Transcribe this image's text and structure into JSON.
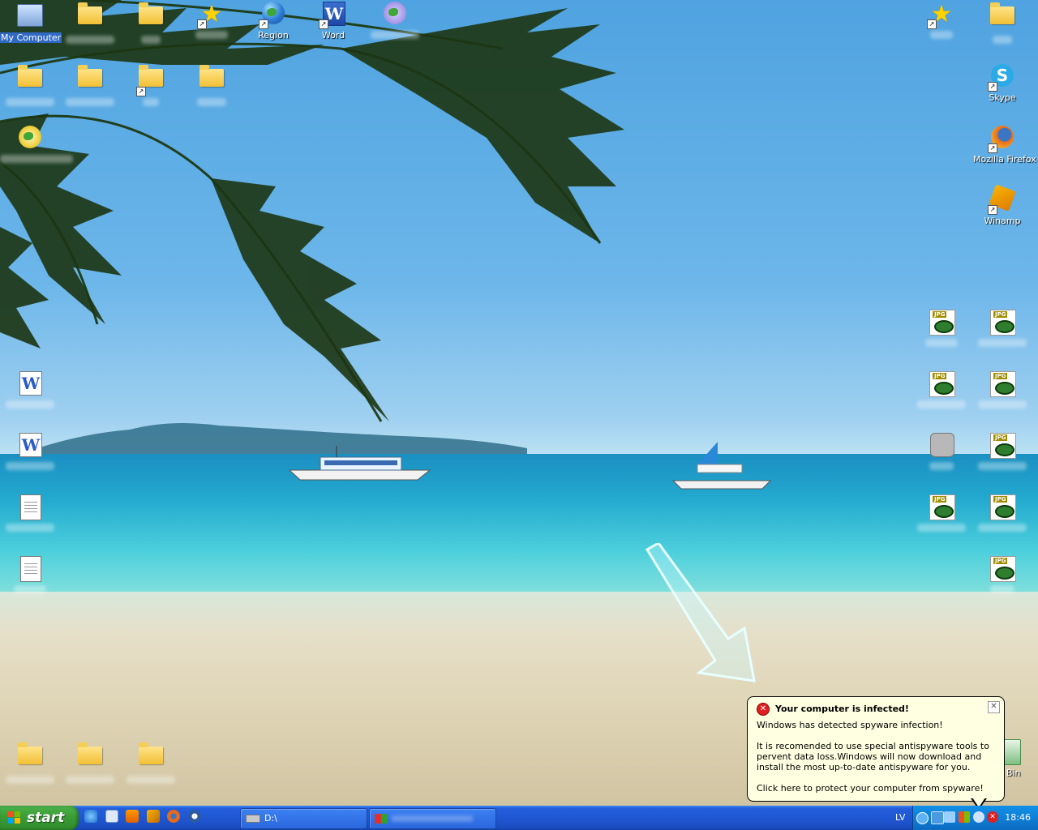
{
  "desktop": {
    "icons_left_top": [
      {
        "label": "My Computer",
        "type": "computer",
        "selected": true
      },
      {
        "label": "",
        "type": "folder"
      },
      {
        "label": "",
        "type": "folder"
      },
      {
        "label": "",
        "type": "star"
      },
      {
        "label": "Region",
        "type": "globe",
        "shortcut": true
      },
      {
        "label": "Word",
        "type": "word",
        "shortcut": true
      },
      {
        "label": "",
        "type": "blurred"
      }
    ],
    "icons_right": [
      {
        "label": "Skype",
        "type": "skype",
        "shortcut": true
      },
      {
        "label": "Mozilla Firefox",
        "type": "firefox",
        "shortcut": true
      },
      {
        "label": "Winamp",
        "type": "winamp",
        "shortcut": true
      },
      {
        "label": "le Bin",
        "type": "recycle"
      }
    ]
  },
  "balloon": {
    "title": "Your computer is infected!",
    "line1": "Windows has detected spyware infection!",
    "line2": "It is recomended to use special antispyware tools to pervent data loss.Windows will now download and install the most up-to-date antispyware for you.",
    "line3": "Click here to protect your computer from spyware!",
    "close_glyph": "✕",
    "icon_glyph": "✕"
  },
  "taskbar": {
    "start_label": "start",
    "tasks": [
      {
        "label": "D:\\"
      },
      {
        "label": ""
      }
    ],
    "language": "LV",
    "clock": "18:46",
    "alert_glyph": "✕"
  },
  "colors": {
    "taskbar": "#245edb",
    "start": "#3c9c36",
    "balloon_bg": "#ffffe1",
    "alert": "#e02020"
  }
}
